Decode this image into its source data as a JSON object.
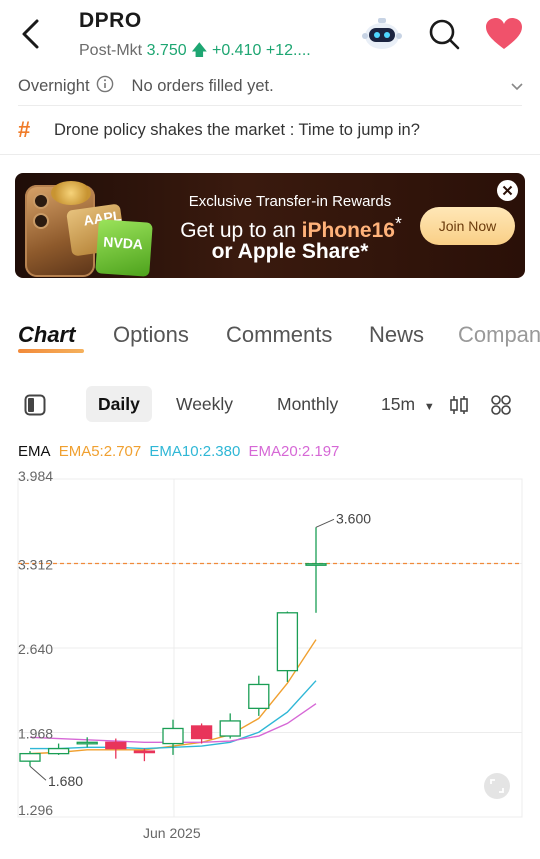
{
  "header": {
    "ticker": "DPRO",
    "session_label": "Post-Mkt",
    "price": "3.750",
    "change": "+0.410",
    "change_pct": "+12....",
    "colors": {
      "up": "#1ea672",
      "heart": "#f0526b"
    }
  },
  "overnight": {
    "label": "Overnight",
    "message": "No orders filled yet."
  },
  "topic": {
    "text": "Drone policy shakes the market : Time to jump in?"
  },
  "banner": {
    "card1": "AAPL",
    "card2": "NVDA",
    "title": "Exclusive Transfer-in Rewards",
    "line2_prefix": "Get up to an ",
    "line2_highlight": "iPhone16",
    "line2_mark": "*",
    "line3": "or Apple Share*",
    "button": "Join Now"
  },
  "tabs": [
    "Chart",
    "Options",
    "Comments",
    "News",
    "Company"
  ],
  "periods": {
    "daily": "Daily",
    "weekly": "Weekly",
    "monthly": "Monthly",
    "interval": "15m"
  },
  "ema": {
    "label": "EMA",
    "ema5": "EMA5:2.707",
    "ema10": "EMA10:2.380",
    "ema20": "EMA20:2.197",
    "colors": {
      "ema5": "#f0a030",
      "ema10": "#2fb7d6",
      "ema20": "#d668d6"
    }
  },
  "chart_data": {
    "type": "candlestick",
    "y_ticks": [
      "3.984",
      "3.312",
      "2.640",
      "1.968",
      "1.296"
    ],
    "y_tick_values": [
      3.984,
      3.312,
      2.64,
      1.968,
      1.296
    ],
    "ylim": [
      1.296,
      3.984
    ],
    "x_tick_label": "Jun 2025",
    "max_label": "3.600",
    "min_label": "1.680",
    "current_price_line": 3.312,
    "candles": [
      {
        "o": 1.74,
        "c": 1.8,
        "h": 1.82,
        "l": 1.7
      },
      {
        "o": 1.8,
        "c": 1.84,
        "h": 1.88,
        "l": 1.79
      },
      {
        "o": 1.88,
        "c": 1.89,
        "h": 1.93,
        "l": 1.85
      },
      {
        "o": 1.89,
        "c": 1.84,
        "h": 1.92,
        "l": 1.76
      },
      {
        "o": 1.82,
        "c": 1.81,
        "h": 1.84,
        "l": 1.74
      },
      {
        "o": 1.88,
        "c": 2.0,
        "h": 2.07,
        "l": 1.79
      },
      {
        "o": 2.02,
        "c": 1.92,
        "h": 2.04,
        "l": 1.88
      },
      {
        "o": 1.94,
        "c": 2.06,
        "h": 2.12,
        "l": 1.92
      },
      {
        "o": 2.16,
        "c": 2.35,
        "h": 2.42,
        "l": 2.1
      },
      {
        "o": 2.46,
        "c": 2.92,
        "h": 2.93,
        "l": 2.37
      },
      {
        "o": 3.31,
        "c": 3.31,
        "h": 3.6,
        "l": 2.92
      }
    ],
    "series": [
      {
        "name": "EMA5",
        "values": [
          1.8,
          1.81,
          1.83,
          1.83,
          1.83,
          1.86,
          1.89,
          1.95,
          2.08,
          2.36,
          2.707
        ]
      },
      {
        "name": "EMA10",
        "values": [
          1.84,
          1.84,
          1.85,
          1.85,
          1.84,
          1.85,
          1.86,
          1.89,
          1.97,
          2.13,
          2.38
        ]
      },
      {
        "name": "EMA20",
        "values": [
          1.93,
          1.92,
          1.91,
          1.9,
          1.89,
          1.89,
          1.89,
          1.9,
          1.94,
          2.04,
          2.197
        ]
      }
    ],
    "colors": {
      "up": "#1a9e55",
      "down": "#e8345a",
      "price_line": "#f08a3a",
      "grid": "#ececec"
    }
  }
}
